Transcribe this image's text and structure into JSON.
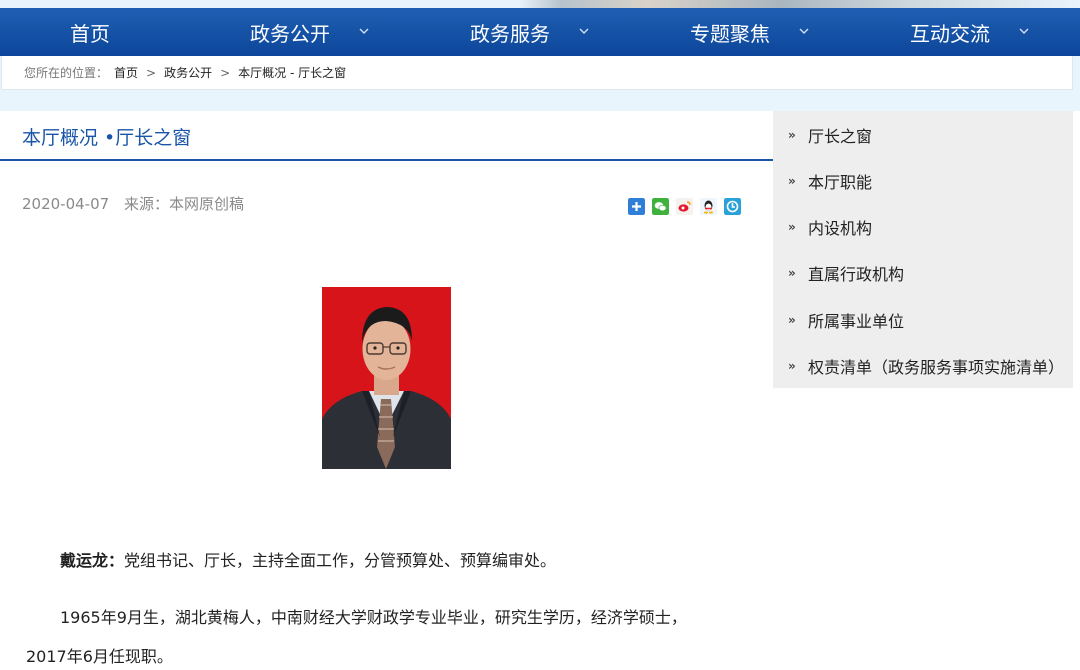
{
  "nav": {
    "items": [
      {
        "label": "首页",
        "has_dropdown": false
      },
      {
        "label": "政务公开",
        "has_dropdown": true
      },
      {
        "label": "政务服务",
        "has_dropdown": true
      },
      {
        "label": "专题聚焦",
        "has_dropdown": true
      },
      {
        "label": "互动交流",
        "has_dropdown": true
      }
    ]
  },
  "breadcrumb": {
    "prefix": "您所在的位置：",
    "items": [
      "首页",
      "政务公开",
      "本厅概况 - 厅长之窗"
    ],
    "separator": ">"
  },
  "article": {
    "section_title": "本厅概况 •厅长之窗",
    "date": "2020-04-07",
    "source": "来源：本网原创稿",
    "share_icons": [
      "plus-share-icon",
      "wechat-icon",
      "weibo-icon",
      "qq-icon",
      "qzone-icon"
    ],
    "name": "戴运龙：",
    "duty": "党组书记、厅长，主持全面工作，分管预算处、预算编审处。",
    "bio_line1": "1965年9月生，湖北黄梅人，中南财经大学财政学专业毕业，研究生学历，经济学硕士，",
    "bio_line2": "2017年6月任现职。"
  },
  "sidebar": {
    "items": [
      {
        "label": "厅长之窗"
      },
      {
        "label": "本厅职能"
      },
      {
        "label": "内设机构"
      },
      {
        "label": "直属行政机构"
      },
      {
        "label": "所属事业单位"
      },
      {
        "label": "权责清单（政务服务事项实施清单）"
      }
    ],
    "arrow": "»"
  },
  "colors": {
    "nav_bg": "#1559ab",
    "title_blue": "#1a56a8",
    "sidebar_bg": "#eeeeee",
    "breadcrumb_bg": "#e9f5fc"
  }
}
